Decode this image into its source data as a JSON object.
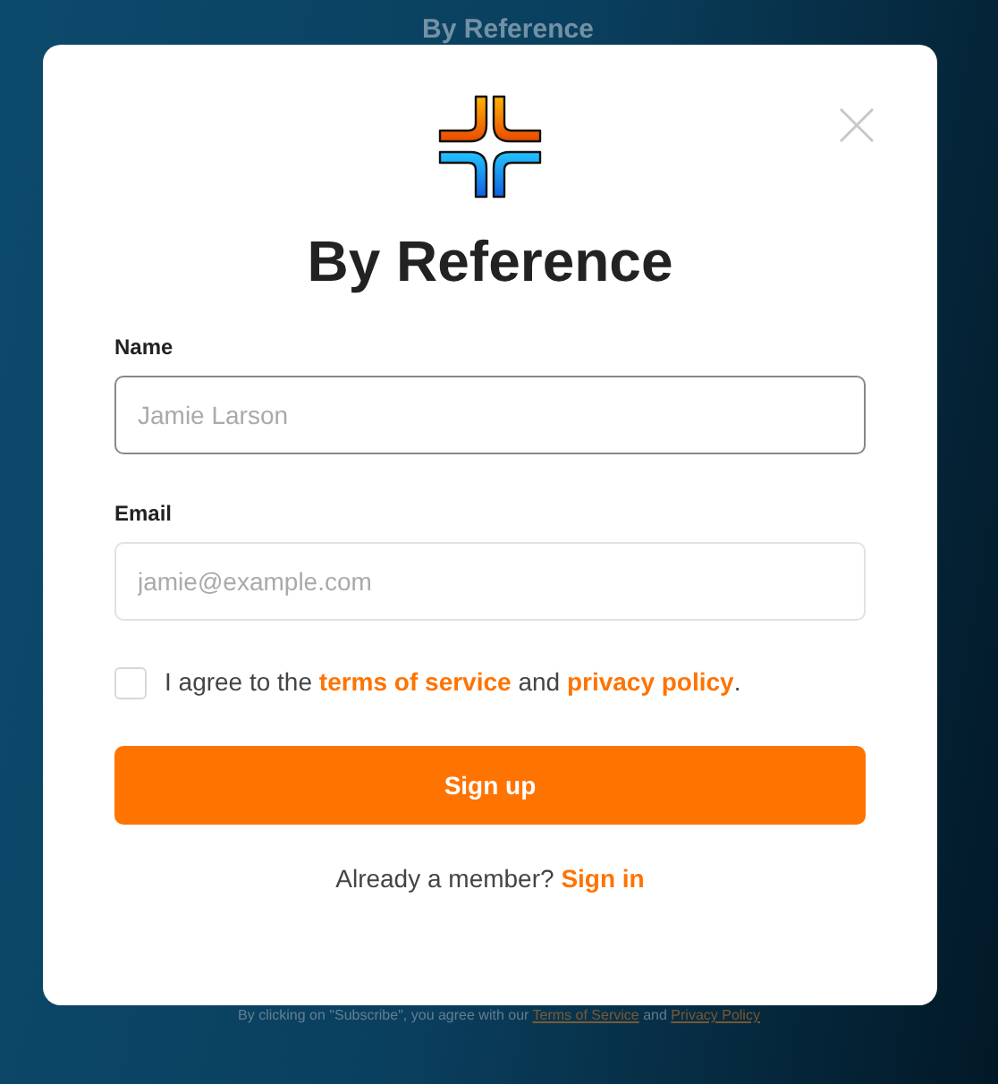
{
  "background": {
    "brand": "By Reference",
    "footer_note": {
      "text": "By clicking on \"Subscribe\", you agree with our",
      "terms_link": "Terms of Service",
      "joiner": "and",
      "privacy_link": "Privacy Policy"
    }
  },
  "dialog": {
    "title": "By Reference",
    "fields": [
      {
        "label": "Name",
        "placeholder": "Jamie Larson",
        "focused": true
      },
      {
        "label": "Email",
        "placeholder": "jamie@example.com",
        "focused": false
      }
    ],
    "agreement": {
      "checked": false,
      "prefix": "I agree to the",
      "terms_link": "terms of service",
      "joiner": "and",
      "privacy_link": "privacy policy",
      "suffix": "."
    },
    "submit": "Sign up",
    "member": {
      "prompt": "Already a member?",
      "link": "Sign in"
    }
  }
}
